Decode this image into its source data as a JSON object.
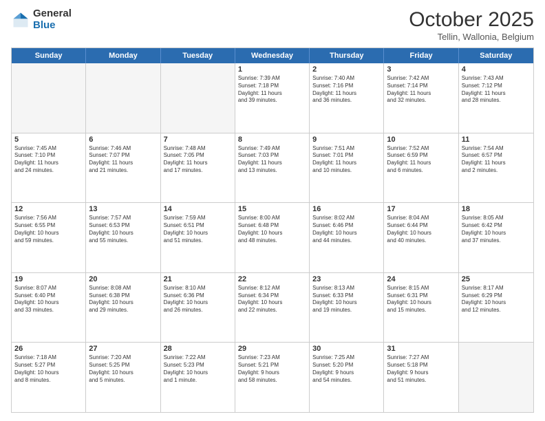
{
  "header": {
    "logo_general": "General",
    "logo_blue": "Blue",
    "month": "October 2025",
    "location": "Tellin, Wallonia, Belgium"
  },
  "days_of_week": [
    "Sunday",
    "Monday",
    "Tuesday",
    "Wednesday",
    "Thursday",
    "Friday",
    "Saturday"
  ],
  "weeks": [
    [
      {
        "day": "",
        "info": ""
      },
      {
        "day": "",
        "info": ""
      },
      {
        "day": "",
        "info": ""
      },
      {
        "day": "1",
        "info": "Sunrise: 7:39 AM\nSunset: 7:18 PM\nDaylight: 11 hours\nand 39 minutes."
      },
      {
        "day": "2",
        "info": "Sunrise: 7:40 AM\nSunset: 7:16 PM\nDaylight: 11 hours\nand 36 minutes."
      },
      {
        "day": "3",
        "info": "Sunrise: 7:42 AM\nSunset: 7:14 PM\nDaylight: 11 hours\nand 32 minutes."
      },
      {
        "day": "4",
        "info": "Sunrise: 7:43 AM\nSunset: 7:12 PM\nDaylight: 11 hours\nand 28 minutes."
      }
    ],
    [
      {
        "day": "5",
        "info": "Sunrise: 7:45 AM\nSunset: 7:10 PM\nDaylight: 11 hours\nand 24 minutes."
      },
      {
        "day": "6",
        "info": "Sunrise: 7:46 AM\nSunset: 7:07 PM\nDaylight: 11 hours\nand 21 minutes."
      },
      {
        "day": "7",
        "info": "Sunrise: 7:48 AM\nSunset: 7:05 PM\nDaylight: 11 hours\nand 17 minutes."
      },
      {
        "day": "8",
        "info": "Sunrise: 7:49 AM\nSunset: 7:03 PM\nDaylight: 11 hours\nand 13 minutes."
      },
      {
        "day": "9",
        "info": "Sunrise: 7:51 AM\nSunset: 7:01 PM\nDaylight: 11 hours\nand 10 minutes."
      },
      {
        "day": "10",
        "info": "Sunrise: 7:52 AM\nSunset: 6:59 PM\nDaylight: 11 hours\nand 6 minutes."
      },
      {
        "day": "11",
        "info": "Sunrise: 7:54 AM\nSunset: 6:57 PM\nDaylight: 11 hours\nand 2 minutes."
      }
    ],
    [
      {
        "day": "12",
        "info": "Sunrise: 7:56 AM\nSunset: 6:55 PM\nDaylight: 10 hours\nand 59 minutes."
      },
      {
        "day": "13",
        "info": "Sunrise: 7:57 AM\nSunset: 6:53 PM\nDaylight: 10 hours\nand 55 minutes."
      },
      {
        "day": "14",
        "info": "Sunrise: 7:59 AM\nSunset: 6:51 PM\nDaylight: 10 hours\nand 51 minutes."
      },
      {
        "day": "15",
        "info": "Sunrise: 8:00 AM\nSunset: 6:48 PM\nDaylight: 10 hours\nand 48 minutes."
      },
      {
        "day": "16",
        "info": "Sunrise: 8:02 AM\nSunset: 6:46 PM\nDaylight: 10 hours\nand 44 minutes."
      },
      {
        "day": "17",
        "info": "Sunrise: 8:04 AM\nSunset: 6:44 PM\nDaylight: 10 hours\nand 40 minutes."
      },
      {
        "day": "18",
        "info": "Sunrise: 8:05 AM\nSunset: 6:42 PM\nDaylight: 10 hours\nand 37 minutes."
      }
    ],
    [
      {
        "day": "19",
        "info": "Sunrise: 8:07 AM\nSunset: 6:40 PM\nDaylight: 10 hours\nand 33 minutes."
      },
      {
        "day": "20",
        "info": "Sunrise: 8:08 AM\nSunset: 6:38 PM\nDaylight: 10 hours\nand 29 minutes."
      },
      {
        "day": "21",
        "info": "Sunrise: 8:10 AM\nSunset: 6:36 PM\nDaylight: 10 hours\nand 26 minutes."
      },
      {
        "day": "22",
        "info": "Sunrise: 8:12 AM\nSunset: 6:34 PM\nDaylight: 10 hours\nand 22 minutes."
      },
      {
        "day": "23",
        "info": "Sunrise: 8:13 AM\nSunset: 6:33 PM\nDaylight: 10 hours\nand 19 minutes."
      },
      {
        "day": "24",
        "info": "Sunrise: 8:15 AM\nSunset: 6:31 PM\nDaylight: 10 hours\nand 15 minutes."
      },
      {
        "day": "25",
        "info": "Sunrise: 8:17 AM\nSunset: 6:29 PM\nDaylight: 10 hours\nand 12 minutes."
      }
    ],
    [
      {
        "day": "26",
        "info": "Sunrise: 7:18 AM\nSunset: 5:27 PM\nDaylight: 10 hours\nand 8 minutes."
      },
      {
        "day": "27",
        "info": "Sunrise: 7:20 AM\nSunset: 5:25 PM\nDaylight: 10 hours\nand 5 minutes."
      },
      {
        "day": "28",
        "info": "Sunrise: 7:22 AM\nSunset: 5:23 PM\nDaylight: 10 hours\nand 1 minute."
      },
      {
        "day": "29",
        "info": "Sunrise: 7:23 AM\nSunset: 5:21 PM\nDaylight: 9 hours\nand 58 minutes."
      },
      {
        "day": "30",
        "info": "Sunrise: 7:25 AM\nSunset: 5:20 PM\nDaylight: 9 hours\nand 54 minutes."
      },
      {
        "day": "31",
        "info": "Sunrise: 7:27 AM\nSunset: 5:18 PM\nDaylight: 9 hours\nand 51 minutes."
      },
      {
        "day": "",
        "info": ""
      }
    ]
  ]
}
